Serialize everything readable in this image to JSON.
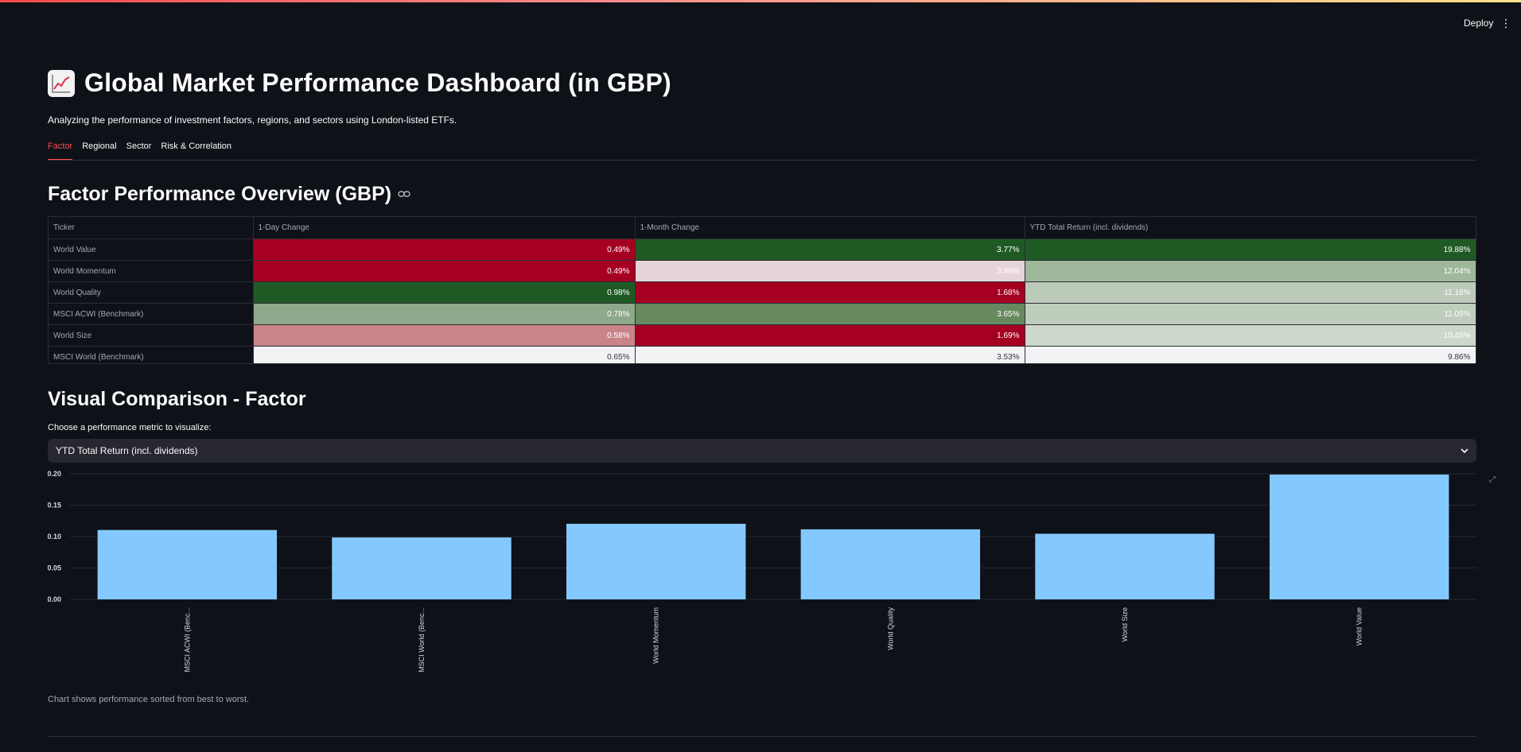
{
  "header": {
    "deploy_label": "Deploy",
    "menu_icon": "kebab-menu-icon"
  },
  "page": {
    "title": "Global Market Performance Dashboard (in GBP)",
    "title_icon": "chart-increasing-icon",
    "subtitle": "Analyzing the performance of investment factors, regions, and sectors using London-listed ETFs."
  },
  "tabs": [
    {
      "label": "Factor",
      "active": true
    },
    {
      "label": "Regional",
      "active": false
    },
    {
      "label": "Sector",
      "active": false
    },
    {
      "label": "Risk & Correlation",
      "active": false
    }
  ],
  "overview": {
    "title": "Factor Performance Overview (GBP)",
    "link_icon": "link-icon",
    "columns": [
      "Ticker",
      "1-Day Change",
      "1-Month Change",
      "YTD Total Return (incl. dividends)"
    ],
    "rows": [
      {
        "ticker": "World Value",
        "cells": [
          {
            "text": "0.49%",
            "bg": "#a50021",
            "fg": "#ffffff"
          },
          {
            "text": "3.77%",
            "bg": "#1f5a25",
            "fg": "#ffffff"
          },
          {
            "text": "19.88%",
            "bg": "#1f5a25",
            "fg": "#ffffff"
          }
        ]
      },
      {
        "ticker": "World Momentum",
        "cells": [
          {
            "text": "0.49%",
            "bg": "#a50021",
            "fg": "#ffffff"
          },
          {
            "text": "3.49%",
            "bg": "#e6d4d8",
            "fg": "#ffffff"
          },
          {
            "text": "12.04%",
            "bg": "#9fb79b",
            "fg": "#ffffff"
          }
        ]
      },
      {
        "ticker": "World Quality",
        "cells": [
          {
            "text": "0.98%",
            "bg": "#1f5a25",
            "fg": "#ffffff"
          },
          {
            "text": "1.68%",
            "bg": "#a50021",
            "fg": "#ffffff"
          },
          {
            "text": "11.16%",
            "bg": "#bccbb9",
            "fg": "#ffffff"
          }
        ]
      },
      {
        "ticker": "MSCI ACWI (Benchmark)",
        "cells": [
          {
            "text": "0.78%",
            "bg": "#8da88a",
            "fg": "#ffffff"
          },
          {
            "text": "3.65%",
            "bg": "#66895f",
            "fg": "#ffffff"
          },
          {
            "text": "11.05%",
            "bg": "#bfcdbc",
            "fg": "#ffffff"
          }
        ]
      },
      {
        "ticker": "World Size",
        "cells": [
          {
            "text": "0.58%",
            "bg": "#c98489",
            "fg": "#ffffff"
          },
          {
            "text": "1.69%",
            "bg": "#a50021",
            "fg": "#ffffff"
          },
          {
            "text": "10.45%",
            "bg": "#ccd8ca",
            "fg": "#ffffff"
          }
        ]
      },
      {
        "ticker": "MSCI World (Benchmark)",
        "cells": [
          {
            "text": "0.65%",
            "bg": "#f3f3f6",
            "fg": "#31333f"
          },
          {
            "text": "3.53%",
            "bg": "#f3f3f6",
            "fg": "#31333f"
          },
          {
            "text": "9.86%",
            "bg": "#f3f3f6",
            "fg": "#31333f"
          }
        ]
      }
    ]
  },
  "visual": {
    "title": "Visual Comparison - Factor",
    "metric_label": "Choose a performance metric to visualize:",
    "selected_metric": "YTD Total Return (incl. dividends)",
    "caption": "Chart shows performance sorted from best to worst.",
    "expand_icon": "fullscreen-icon"
  },
  "chart_data": {
    "type": "bar",
    "categories": [
      "MSCI ACWI (Benc...",
      "MSCI World (Benc...",
      "World Momentum",
      "World Quality",
      "World Size",
      "World Value"
    ],
    "values": [
      0.1105,
      0.0986,
      0.1204,
      0.1116,
      0.1045,
      0.1988
    ],
    "yticks": [
      "0.00",
      "0.05",
      "0.10",
      "0.15",
      "0.20"
    ],
    "ylim": [
      0,
      0.2
    ],
    "bar_color": "#83c9ff",
    "grid": true
  }
}
